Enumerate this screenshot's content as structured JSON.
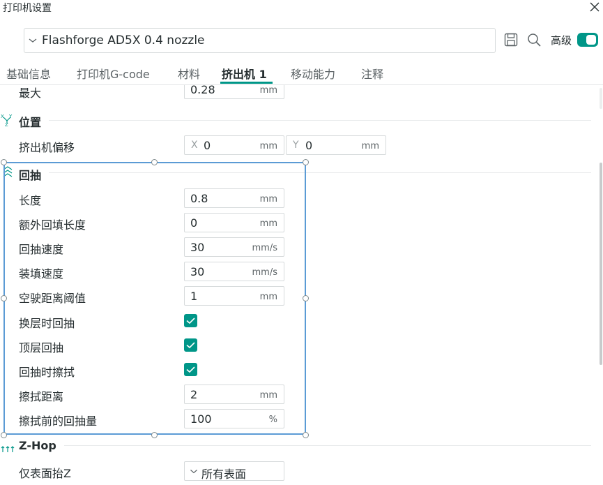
{
  "window": {
    "title": "打印机设置"
  },
  "preset": {
    "value": "Flashforge AD5X 0.4 nozzle"
  },
  "toolbar": {
    "advanced_label": "高级",
    "advanced_on": true
  },
  "tabs": [
    {
      "label": "基础信息",
      "active": false
    },
    {
      "label": "打印机G-code",
      "active": false
    },
    {
      "label": "材料",
      "active": false
    },
    {
      "label": "挤出机 1",
      "active": true
    },
    {
      "label": "移动能力",
      "active": false
    },
    {
      "label": "注释",
      "active": false
    }
  ],
  "layer_height": {
    "label": "最大",
    "value": "0.28",
    "unit": "mm"
  },
  "position": {
    "title": "位置",
    "extruder_offset": {
      "label": "挤出机偏移",
      "x_prefix": "X",
      "x": "0",
      "y_prefix": "Y",
      "y": "0",
      "unit": "mm"
    }
  },
  "retraction": {
    "title": "回抽",
    "length": {
      "label": "长度",
      "value": "0.8",
      "unit": "mm"
    },
    "extra_restart": {
      "label": "额外回填长度",
      "value": "0",
      "unit": "mm"
    },
    "retract_speed": {
      "label": "回抽速度",
      "value": "30",
      "unit": "mm/s"
    },
    "deretract_speed": {
      "label": "装填速度",
      "value": "30",
      "unit": "mm/s"
    },
    "travel_threshold": {
      "label": "空驶距离阈值",
      "value": "1",
      "unit": "mm"
    },
    "layer_change": {
      "label": "换层时回抽",
      "checked": true
    },
    "top_layer": {
      "label": "顶层回抽",
      "checked": true
    },
    "wipe": {
      "label": "回抽时擦拭",
      "checked": true
    },
    "wipe_distance": {
      "label": "擦拭距离",
      "value": "2",
      "unit": "mm"
    },
    "retract_before_wipe": {
      "label": "擦拭前的回抽量",
      "value": "100",
      "unit": "%"
    }
  },
  "zhop": {
    "title": "Z-Hop",
    "surface": {
      "label": "仅表面抬Z",
      "value": "所有表面"
    }
  },
  "colors": {
    "accent": "#009688",
    "selection": "#5b9bd5",
    "text": "#262e30"
  }
}
